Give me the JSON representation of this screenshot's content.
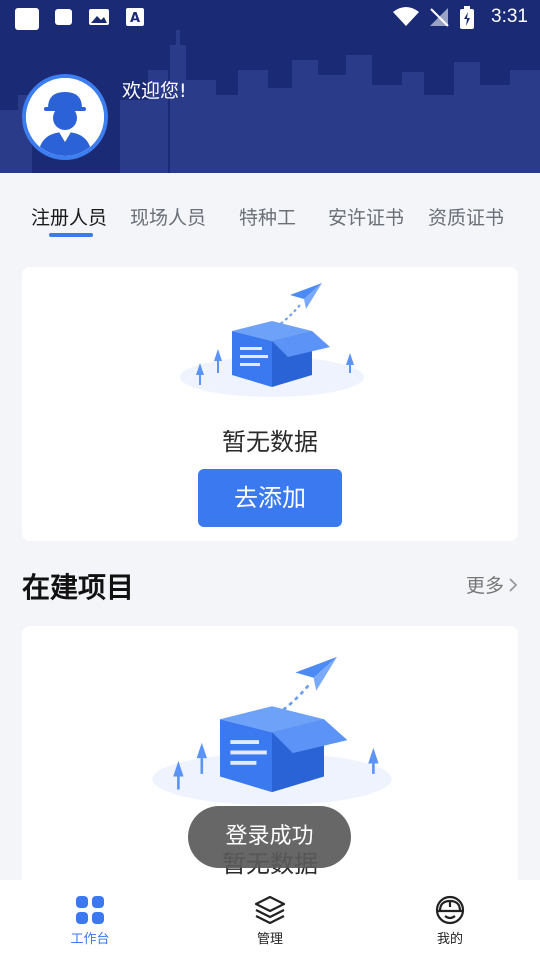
{
  "status_bar": {
    "time": "3:31"
  },
  "header": {
    "welcome": "欢迎您!"
  },
  "tabs": [
    {
      "label": "注册人员",
      "active": true
    },
    {
      "label": "现场人员",
      "active": false
    },
    {
      "label": "特种工",
      "active": false
    },
    {
      "label": "安许证书",
      "active": false
    },
    {
      "label": "资质证书",
      "active": false
    }
  ],
  "card1": {
    "empty_text": "暂无数据",
    "add_button": "去添加"
  },
  "projects": {
    "title": "在建项目",
    "more": "更多",
    "empty_text": "暂无数据"
  },
  "toast": "登录成功",
  "bottom_nav": [
    {
      "label": "工作台",
      "icon": "grid-icon",
      "active": true
    },
    {
      "label": "管理",
      "icon": "layers-icon",
      "active": false
    },
    {
      "label": "我的",
      "icon": "helmet-icon",
      "active": false
    }
  ],
  "colors": {
    "header_bg": "#1b2a74",
    "accent": "#3b79f1"
  }
}
